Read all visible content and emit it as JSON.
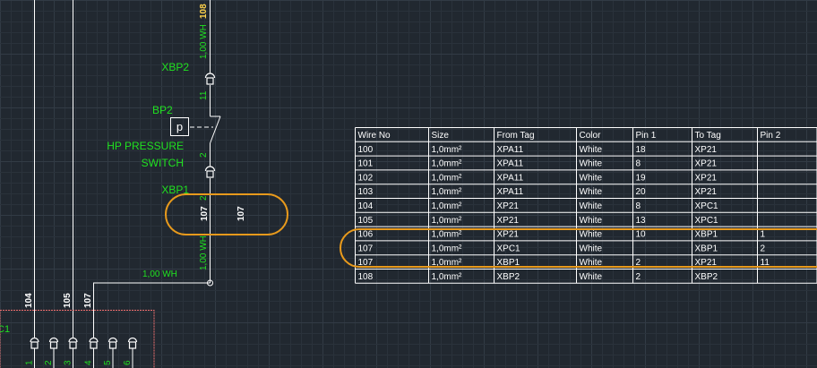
{
  "colors": {
    "background": "#212830",
    "grid_minor": "#2a323b",
    "grid_major": "#323b45",
    "wire": "#ffffff",
    "label_green": "#20e020",
    "label_yellow": "#ffd24a",
    "highlight": "#e89a1c",
    "connector": "#f07070"
  },
  "schematic": {
    "wire_no_top": "108",
    "wire_top_spec": "1,00 WH",
    "xbp2_label": "XBP2",
    "pin_11": "11",
    "bp2_label": "BP2",
    "sensor_symbol": "p",
    "switch_name_line1": "HP PRESSURE",
    "switch_name_line2": "SWITCH",
    "pin_2_upper": "2",
    "xbp1_label": "XBP1",
    "pin_2_lower": "2",
    "wire_no_a": "107",
    "wire_no_b": "107",
    "wire_bottom_spec": "1,00 WH",
    "wire_branch_spec": "1,00 WH",
    "terminal_wire_nos": [
      "104",
      "105",
      "107"
    ],
    "terminal_pins": [
      "1",
      "2",
      "3",
      "4",
      "5",
      "6"
    ],
    "terminal_strip_label": "C1"
  },
  "wire_table": {
    "headers": [
      "Wire No",
      "Size",
      "From Tag",
      "Color",
      "Pin 1",
      "To Tag",
      "Pin 2"
    ],
    "rows": [
      [
        "100",
        "1,0mm²",
        "XPA11",
        "White",
        "18",
        "XP21",
        ""
      ],
      [
        "101",
        "1,0mm²",
        "XPA11",
        "White",
        "8",
        "XP21",
        ""
      ],
      [
        "102",
        "1,0mm²",
        "XPA11",
        "White",
        "19",
        "XP21",
        ""
      ],
      [
        "103",
        "1,0mm²",
        "XPA11",
        "White",
        "20",
        "XP21",
        ""
      ],
      [
        "104",
        "1,0mm²",
        "XP21",
        "White",
        "8",
        "XPC1",
        ""
      ],
      [
        "105",
        "1,0mm²",
        "XP21",
        "White",
        "13",
        "XPC1",
        ""
      ],
      [
        "106",
        "1,0mm²",
        "XP21",
        "White",
        "10",
        "XBP1",
        "1"
      ],
      [
        "107",
        "1,0mm²",
        "XPC1",
        "White",
        "",
        "XBP1",
        "2"
      ],
      [
        "107",
        "1,0mm²",
        "XBP1",
        "White",
        "2",
        "XP21",
        "11"
      ],
      [
        "108",
        "1,0mm²",
        "XBP2",
        "White",
        "2",
        "XBP2",
        ""
      ]
    ]
  }
}
